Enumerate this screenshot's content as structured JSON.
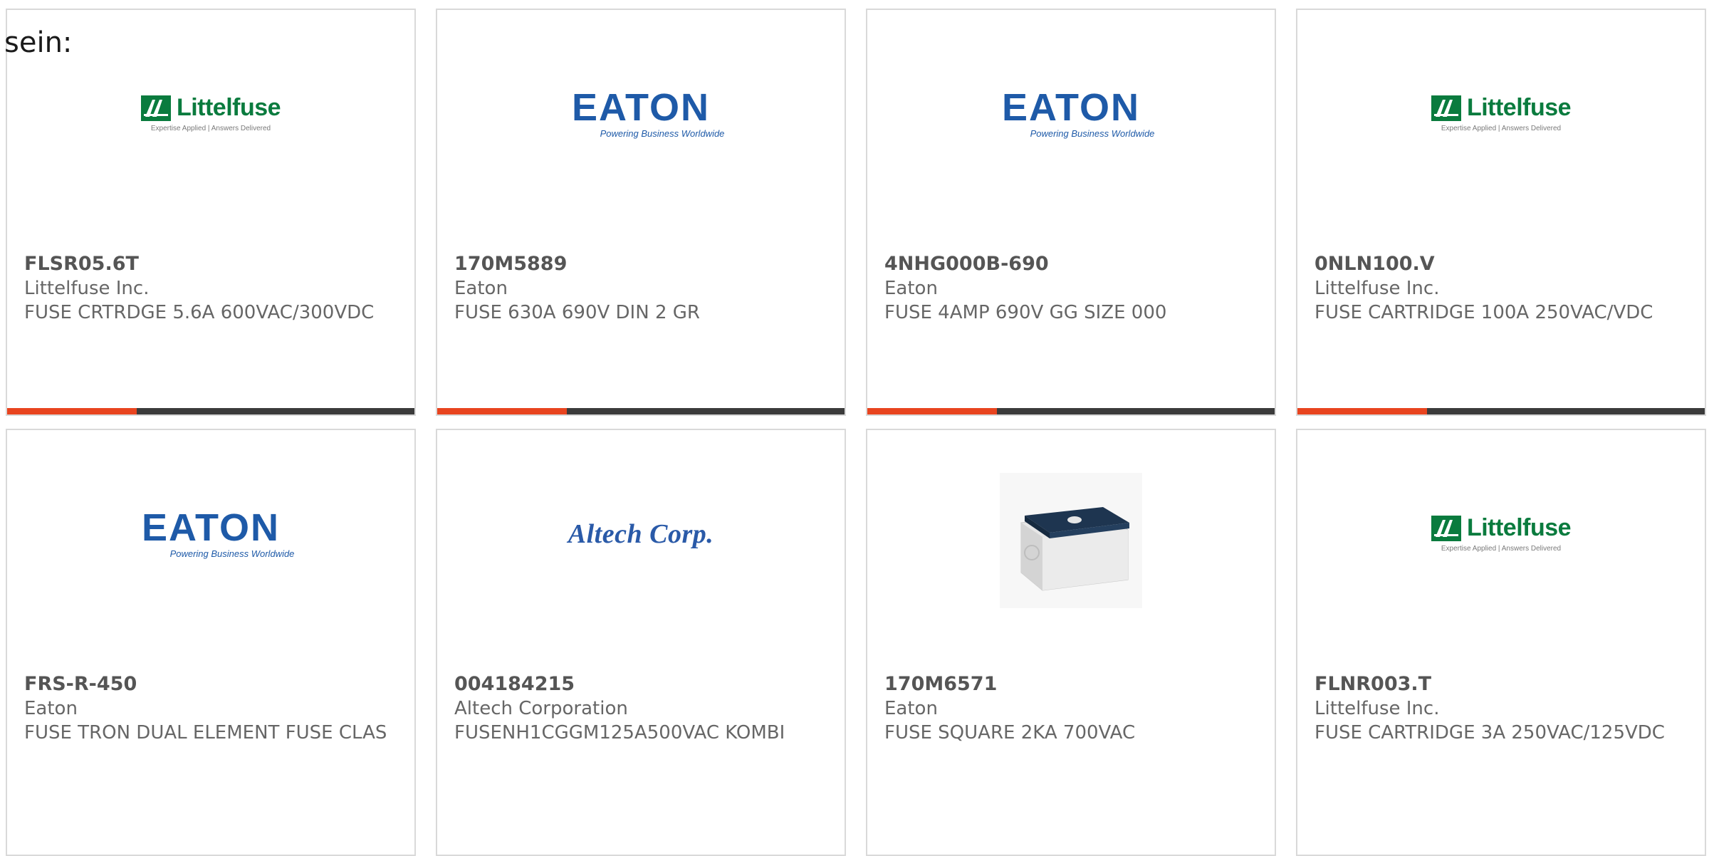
{
  "lead_text": "sein:",
  "products": [
    {
      "brand_logo": "littelfuse",
      "logo_text": "Littelfuse",
      "logo_tagline": "Expertise Applied | Answers Delivered",
      "part_number": "FLSR05.6T",
      "manufacturer": "Littelfuse Inc.",
      "description": "FUSE CRTRDGE 5.6A 600VAC/300VDC"
    },
    {
      "brand_logo": "eaton",
      "logo_text": "EATON",
      "logo_tagline": "Powering Business Worldwide",
      "part_number": "170M5889",
      "manufacturer": "Eaton",
      "description": "FUSE 630A 690V DIN 2 GR"
    },
    {
      "brand_logo": "eaton",
      "logo_text": "EATON",
      "logo_tagline": "Powering Business Worldwide",
      "part_number": "4NHG000B-690",
      "manufacturer": "Eaton",
      "description": "FUSE 4AMP 690V GG SIZE 000"
    },
    {
      "brand_logo": "littelfuse",
      "logo_text": "Littelfuse",
      "logo_tagline": "Expertise Applied | Answers Delivered",
      "part_number": "0NLN100.V",
      "manufacturer": "Littelfuse Inc.",
      "description": "FUSE CARTRIDGE 100A 250VAC/VDC"
    },
    {
      "brand_logo": "eaton",
      "logo_text": "EATON",
      "logo_tagline": "Powering Business Worldwide",
      "part_number": "FRS-R-450",
      "manufacturer": "Eaton",
      "description": "FUSE TRON DUAL ELEMENT FUSE CLAS"
    },
    {
      "brand_logo": "altech",
      "logo_text": "Altech Corp.",
      "logo_tagline": "",
      "part_number": "004184215",
      "manufacturer": "Altech Corporation",
      "description": "FUSENH1CGGM125A500VAC KOMBI"
    },
    {
      "brand_logo": "product-photo",
      "logo_text": "",
      "logo_tagline": "",
      "part_number": "170M6571",
      "manufacturer": "Eaton",
      "description": "FUSE SQUARE 2KA 700VAC"
    },
    {
      "brand_logo": "littelfuse",
      "logo_text": "Littelfuse",
      "logo_tagline": "Expertise Applied | Answers Delivered",
      "part_number": "FLNR003.T",
      "manufacturer": "Littelfuse Inc.",
      "description": "FUSE CARTRIDGE 3A 250VAC/125VDC"
    }
  ],
  "colors": {
    "accent": "#e8441f",
    "bar": "#3b3b3b",
    "littelfuse_green": "#0a7b3e",
    "eaton_blue": "#1e5aa8"
  }
}
